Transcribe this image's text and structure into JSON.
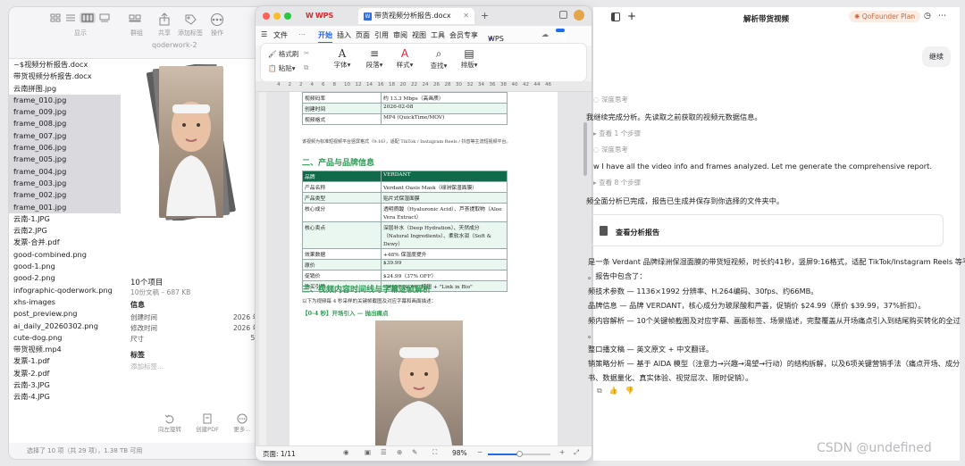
{
  "finder": {
    "toolbar": [
      {
        "label": "显示",
        "icon": "grid-view-icon"
      },
      {
        "label": "群组",
        "icon": "group-icon"
      },
      {
        "label": "共享",
        "icon": "share-icon"
      },
      {
        "label": "添加标签",
        "icon": "tag-icon"
      },
      {
        "label": "操作",
        "icon": "actions-icon"
      }
    ],
    "path": "qoderwork-2",
    "files": [
      {
        "name": "~$视频分析报告.docx",
        "sel": false
      },
      {
        "name": "带货视频分析报告.docx",
        "sel": false
      },
      {
        "name": "云南拼图.jpg",
        "sel": false
      },
      {
        "name": "frame_010.jpg",
        "sel": true
      },
      {
        "name": "frame_009.jpg",
        "sel": true
      },
      {
        "name": "frame_008.jpg",
        "sel": true
      },
      {
        "name": "frame_007.jpg",
        "sel": true
      },
      {
        "name": "frame_006.jpg",
        "sel": true
      },
      {
        "name": "frame_005.jpg",
        "sel": true
      },
      {
        "name": "frame_004.jpg",
        "sel": true
      },
      {
        "name": "frame_003.jpg",
        "sel": true
      },
      {
        "name": "frame_002.jpg",
        "sel": true
      },
      {
        "name": "frame_001.jpg",
        "sel": true
      },
      {
        "name": "云南-1.JPG",
        "sel": false
      },
      {
        "name": "云南2.JPG",
        "sel": false
      },
      {
        "name": "发票-合并.pdf",
        "sel": false
      },
      {
        "name": "good-combined.png",
        "sel": false
      },
      {
        "name": "good-1.png",
        "sel": false
      },
      {
        "name": "good-2.png",
        "sel": false
      },
      {
        "name": "infographic-qoderwork.png",
        "sel": false
      },
      {
        "name": "xhs-images",
        "sel": false
      },
      {
        "name": "post_preview.png",
        "sel": false
      },
      {
        "name": "ai_daily_20260302.png",
        "sel": false
      },
      {
        "name": "cute-dog.png",
        "sel": false
      },
      {
        "name": "带货视频.mp4",
        "sel": false
      },
      {
        "name": "发票-1.pdf",
        "sel": false
      },
      {
        "name": "发票-2.pdf",
        "sel": false
      },
      {
        "name": "云南-3.JPG",
        "sel": false
      },
      {
        "name": "云南-4.JPG",
        "sel": false
      }
    ],
    "preview": {
      "count": "10个项目",
      "size": "10份文稿 – 687 KB",
      "info_title": "信息",
      "created_label": "创建时间",
      "created_value": "2026 年",
      "modified_label": "修改时间",
      "modified_value": "2026 年",
      "dims_label": "尺寸",
      "dims_value": "56",
      "tags_title": "标签",
      "tags_placeholder": "添加标签..."
    },
    "actions": [
      {
        "label": "向左旋转",
        "icon": "rotate-left-icon"
      },
      {
        "label": "创建PDF",
        "icon": "create-pdf-icon"
      },
      {
        "label": "更多...",
        "icon": "more-icon"
      }
    ],
    "status": "选择了 10 项（共 29 项），1.38 TB 可用"
  },
  "wps": {
    "tabs": [
      {
        "label": "WPS Office"
      },
      {
        "label": "带货视频分析报告.docx"
      }
    ],
    "menu": [
      "文件",
      "开始",
      "插入",
      "页面",
      "引用",
      "审阅",
      "视图",
      "工具",
      "会员专享",
      "WPS AI"
    ],
    "share_label": "分享",
    "ribbon": {
      "format_painter": "格式刷",
      "paste": "粘贴",
      "font": "字体",
      "paragraph": "段落",
      "style": "样式",
      "find": "查找",
      "layout": "排版"
    },
    "ruler_ticks": [
      "4",
      "2",
      "2",
      "4",
      "6",
      "8",
      "10",
      "12",
      "14",
      "16",
      "18",
      "20",
      "22",
      "24",
      "26",
      "28",
      "30",
      "32",
      "34",
      "36",
      "38",
      "40",
      "42",
      "44",
      "46"
    ],
    "table1": [
      [
        "视频码率",
        "约 13.3 Mbps（高画质）"
      ],
      [
        "创建时间",
        "2026-02-08"
      ],
      [
        "视频格式",
        "MP4 (QuickTime/MOV)"
      ]
    ],
    "table1_note": "该视频为标准短视频平台竖屏格式（9:16），适配 TikTok / Instagram Reels / 抖音等主流短视频平台。",
    "section2": "二、产品与品牌信息",
    "table2_head": [
      "品牌",
      "VERDANT"
    ],
    "table2": [
      [
        "产品名称",
        "Verdant Oasis Mask（绿洲保湿面膜）"
      ],
      [
        "产品类型",
        "贴片式保湿面膜"
      ],
      [
        "核心成分",
        "透明质酸（Hyaluronic Acid）、芦荟提取物（Aloe Vera Extract）"
      ],
      [
        "核心卖点",
        "深层补水（Deep Hydration）、天然成分（Natural Ingredients）、柔软水润（Soft & Dewy）"
      ],
      [
        "效果数据",
        "+48% 保湿度提升"
      ],
      [
        "原价",
        "$39.99"
      ],
      [
        "促销价",
        "$24.99（37% OFF）"
      ],
      [
        "购买引导",
        "\"SHOP NOW\" 按钮 + \"Link in Bio\""
      ]
    ],
    "section3": "三、视频内容时间线与字幕逐帧解析",
    "section3_sub": "以下为视频每 4 秒采样的关键帧截图及对应字幕和画面描述：",
    "frame_heading": "【0-4 秒】开场引入 — 抛出痛点",
    "status": {
      "page": "页面: 1/11",
      "zoom": "98%"
    }
  },
  "chat": {
    "title": "解析带货视频",
    "plan": "QoFounder Plan",
    "continue_btn": "继续",
    "deep1": "深度思考",
    "msg1": "我继续完成分析。先读取之前获取的视频元数据信息。",
    "steps1": "查看 1 个步骤",
    "deep2": "深度思考",
    "msg2": "w I have all the video info and frames analyzed. Let me generate the comprehensive report.",
    "steps2": "查看 8 个步骤",
    "msg3": "频全面分析已完成，报告已生成并保存到你选择的文件夹中。",
    "report_card": "查看分析报告",
    "sum1": "是一条 Verdant 品牌绿洲保湿面膜的带货短视频，时长约41秒，竖屏9:16格式，适配 TikTok/Instagram Reels 等平",
    "sum2": "。报告中包含了：",
    "b1": "频技术参数 — 1136×1992 分辨率、H.264编码、30fps、约66MB。",
    "b2": "品牌信息 — 品牌 VERDANT，核心成分为玻尿酸和芦荟，促销价 $24.99（原价 $39.99，37%折扣）。",
    "b3": "频内容解析 — 10个关键帧截图及对应字幕、画面标签、场景描述，完整覆盖从开场痛点引入到结尾购买转化的全过",
    "b3b": "。",
    "b4": "整口播文稿 — 英文原文 + 中文翻译。",
    "b5": "销策略分析 — 基于 AIDA 模型（注意力→兴趣→渴望→行动）的结构拆解，以及6项关键营销手法（痛点开场、成分",
    "b5b": "书、数据量化、真实体验、视觉层次、限时促销）。"
  },
  "watermark": "CSDN @undefined"
}
